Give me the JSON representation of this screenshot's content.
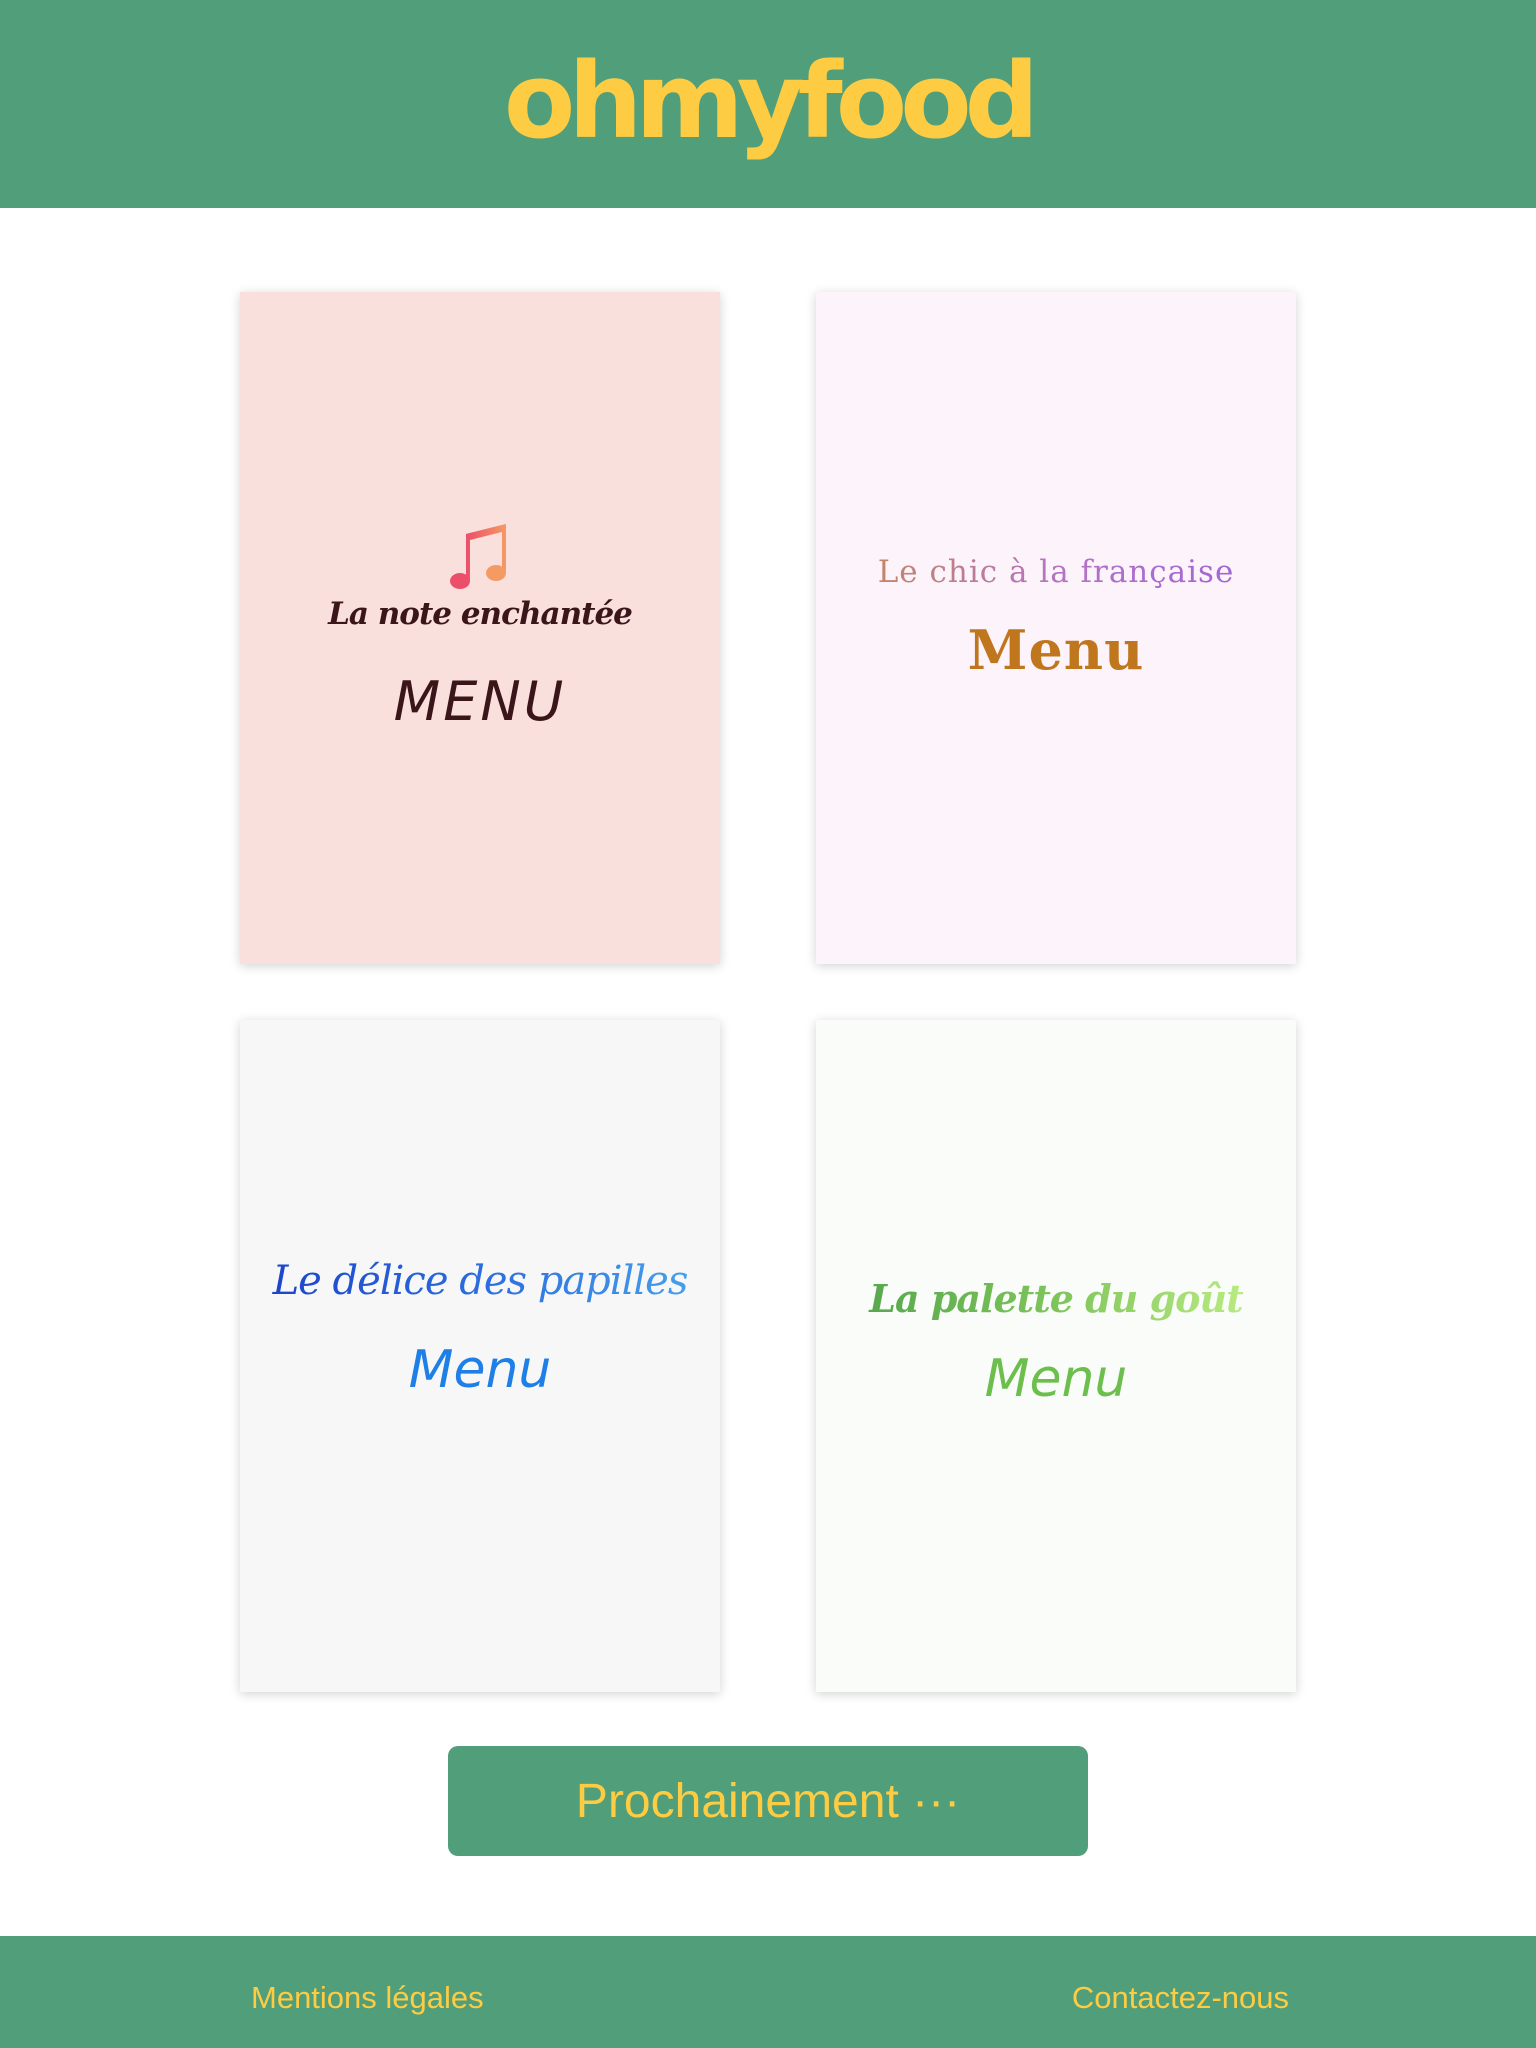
{
  "header": {
    "logo": "ohmyfood"
  },
  "restaurants": [
    {
      "name": "La note enchantée",
      "menu_label": "MENU",
      "icon": "music-note-icon"
    },
    {
      "name": "Le chic à la française",
      "menu_label": "Menu"
    },
    {
      "name": "Le délice des papilles",
      "menu_label": "Menu"
    },
    {
      "name": "La palette du goût",
      "menu_label": "Menu"
    }
  ],
  "coming_soon_button": "Prochainement ···",
  "footer": {
    "legal": "Mentions légales",
    "contact": "Contactez-nous"
  },
  "colors": {
    "brand_green": "#519e7a",
    "brand_yellow": "#fdcc43"
  }
}
